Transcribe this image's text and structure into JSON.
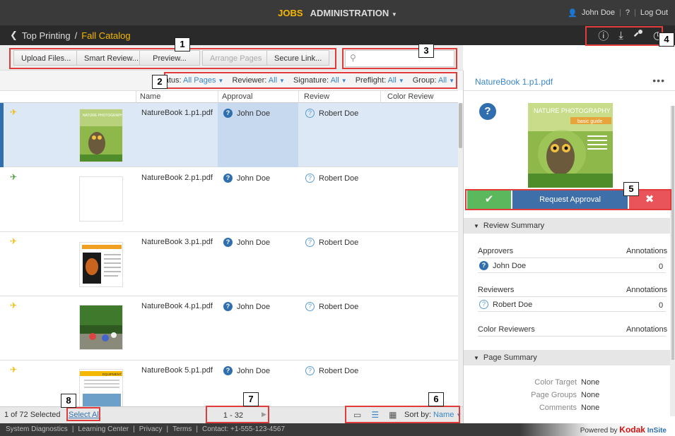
{
  "topbar": {
    "jobs": "JOBS",
    "administration": "ADMINISTRATION",
    "user": "John Doe",
    "help": "?",
    "logout": "Log Out"
  },
  "breadcrumb": {
    "parent": "Top Printing",
    "separator": "/",
    "current": "Fall Catalog"
  },
  "toolbar": {
    "upload": "Upload Files...",
    "smart_review": "Smart Review...",
    "preview": "Preview...",
    "arrange": "Arrange Pages",
    "secure_link": "Secure Link...",
    "search_placeholder": ""
  },
  "filters": [
    {
      "label": "Status:",
      "value": "All Pages"
    },
    {
      "label": "Reviewer:",
      "value": "All"
    },
    {
      "label": "Signature:",
      "value": "All"
    },
    {
      "label": "Preflight:",
      "value": "All"
    },
    {
      "label": "Group:",
      "value": "All"
    }
  ],
  "columns": {
    "name": "Name",
    "approval": "Approval",
    "review": "Review",
    "color_review": "Color Review"
  },
  "rows": [
    {
      "name": "NatureBook 1.p1.pdf",
      "approver": "John Doe",
      "reviewer": "Robert Doe",
      "selected": true
    },
    {
      "name": "NatureBook 2.p1.pdf",
      "approver": "John Doe",
      "reviewer": "Robert Doe",
      "selected": false
    },
    {
      "name": "NatureBook 3.p1.pdf",
      "approver": "John Doe",
      "reviewer": "Robert Doe",
      "selected": false
    },
    {
      "name": "NatureBook 4.p1.pdf",
      "approver": "John Doe",
      "reviewer": "Robert Doe",
      "selected": false
    },
    {
      "name": "NatureBook 5.p1.pdf",
      "approver": "John Doe",
      "reviewer": "Robert Doe",
      "selected": false
    }
  ],
  "thumb_text": {
    "cover_title": "NATURE PHOTOGRAPHY",
    "cover_sub": "basic guide",
    "equipment": "EQUIPMENT"
  },
  "bottom": {
    "selected": "1 of 72 Selected",
    "select_all": "Select All",
    "pager": "1 - 32",
    "sort_label": "Sort by:",
    "sort_value": "Name"
  },
  "footer": {
    "links": [
      "System Diagnostics",
      "|",
      "Learning Center",
      "|",
      "Privacy",
      "|",
      "Terms",
      "|",
      "Contact: +1-555-123-4567"
    ],
    "powered": "Powered by",
    "brand": "Kodak",
    "product": "InSite"
  },
  "panel": {
    "title": "NatureBook 1.p1.pdf",
    "more": "•••",
    "request_approval": "Request Approval",
    "review_summary": "Review Summary",
    "approvers": "Approvers",
    "annotations": "Annotations",
    "approver_name": "John Doe",
    "approver_count": "0",
    "reviewers": "Reviewers",
    "reviewer_name": "Robert Doe",
    "reviewer_count": "0",
    "color_reviewers": "Color Reviewers",
    "page_summary": "Page Summary",
    "color_target_label": "Color Target",
    "color_target_value": "None",
    "page_groups_label": "Page Groups",
    "page_groups_value": "None",
    "comments_label": "Comments",
    "comments_value": "None"
  },
  "callouts": [
    "1",
    "2",
    "3",
    "4",
    "5",
    "6",
    "7",
    "8"
  ],
  "colors": {
    "accent_yellow": "#f5b800",
    "link_blue": "#3a86c8",
    "approve_green": "#5cb85c",
    "reject_red": "#e9535a",
    "request_blue": "#3f6fa8",
    "callout_red": "#e23b3b"
  }
}
